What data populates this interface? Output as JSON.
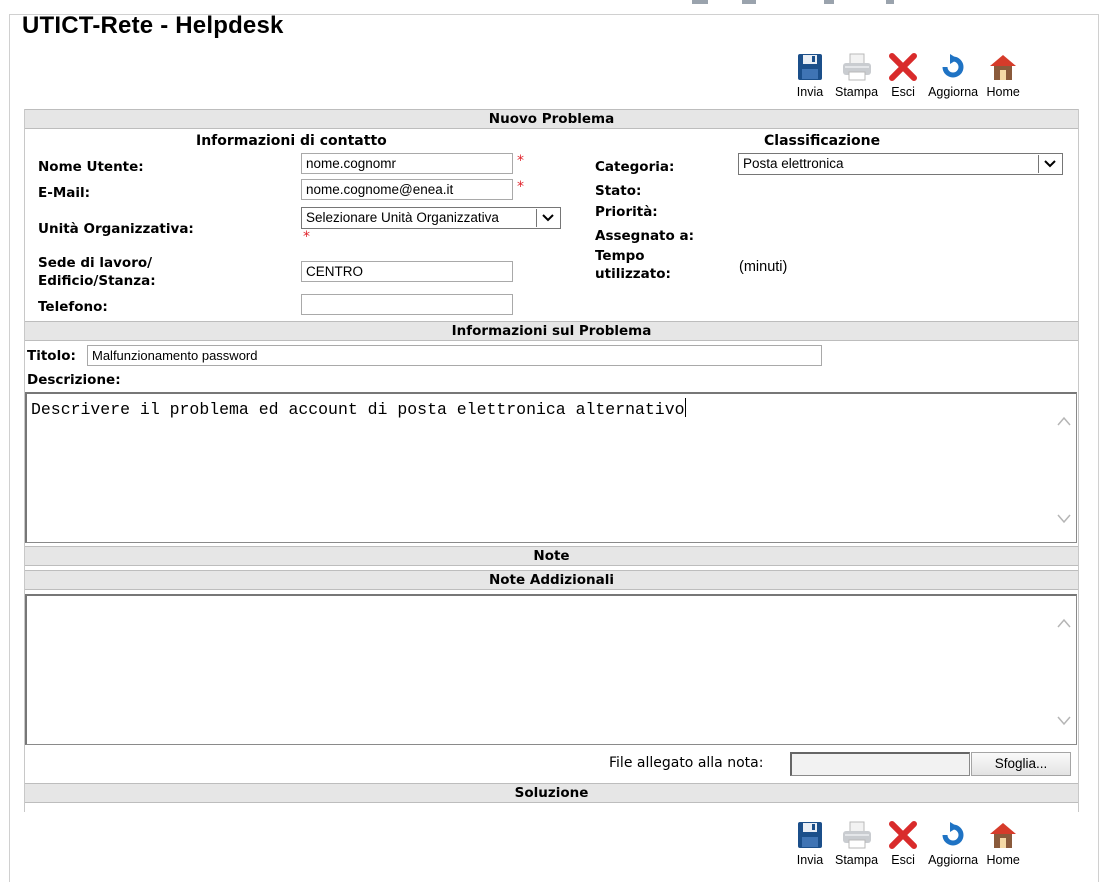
{
  "page": {
    "title": "UTICT-Rete - Helpdesk"
  },
  "toolbar": [
    {
      "label": "Invia",
      "icon": "save-icon"
    },
    {
      "label": "Stampa",
      "icon": "print-icon"
    },
    {
      "label": "Esci",
      "icon": "close-icon"
    },
    {
      "label": "Aggiorna",
      "icon": "refresh-icon"
    },
    {
      "label": "Home",
      "icon": "home-icon"
    }
  ],
  "sections": {
    "nuovo_problema": "Nuovo Problema",
    "info_contatto": "Informazioni di contatto",
    "classificazione": "Classificazione",
    "info_problema": "Informazioni sul Problema",
    "note": "Note",
    "note_addizionali": "Note Addizionali",
    "soluzione": "Soluzione"
  },
  "contact": {
    "nome_utente_label": "Nome Utente:",
    "nome_utente_value": "nome.cognomr",
    "email_label": "E-Mail:",
    "email_value": "nome.cognome@enea.it",
    "unita_label": "Unità Organizzativa:",
    "unita_value": "Selezionare Unità Organizzativa",
    "sede_label_1": "Sede di lavoro/",
    "sede_label_2": "Edificio/Stanza:",
    "sede_value": "CENTRO",
    "telefono_label": "Telefono:",
    "telefono_value": "",
    "required_mark": "*"
  },
  "classification": {
    "categoria_label": "Categoria:",
    "categoria_value": "Posta elettronica",
    "stato_label": "Stato:",
    "priorita_label": "Priorità:",
    "assegnato_label": "Assegnato a:",
    "tempo_label_1": "Tempo",
    "tempo_label_2": "utilizzato:",
    "tempo_unit": "(minuti)"
  },
  "problem": {
    "titolo_label": "Titolo:",
    "titolo_value": "Malfunzionamento password",
    "descrizione_label": "Descrizione:",
    "descrizione_value": "Descrivere il problema ed account di posta elettronica alternativo"
  },
  "notes": {
    "note_value": "",
    "file_label": "File allegato alla nota:",
    "file_value": "",
    "browse_label": "Sfoglia..."
  },
  "colors": {
    "required": "#e0222a",
    "section_bar": "#e6e6e6",
    "icon_blue": "#1b4f8a",
    "icon_red": "#d92b2b"
  }
}
